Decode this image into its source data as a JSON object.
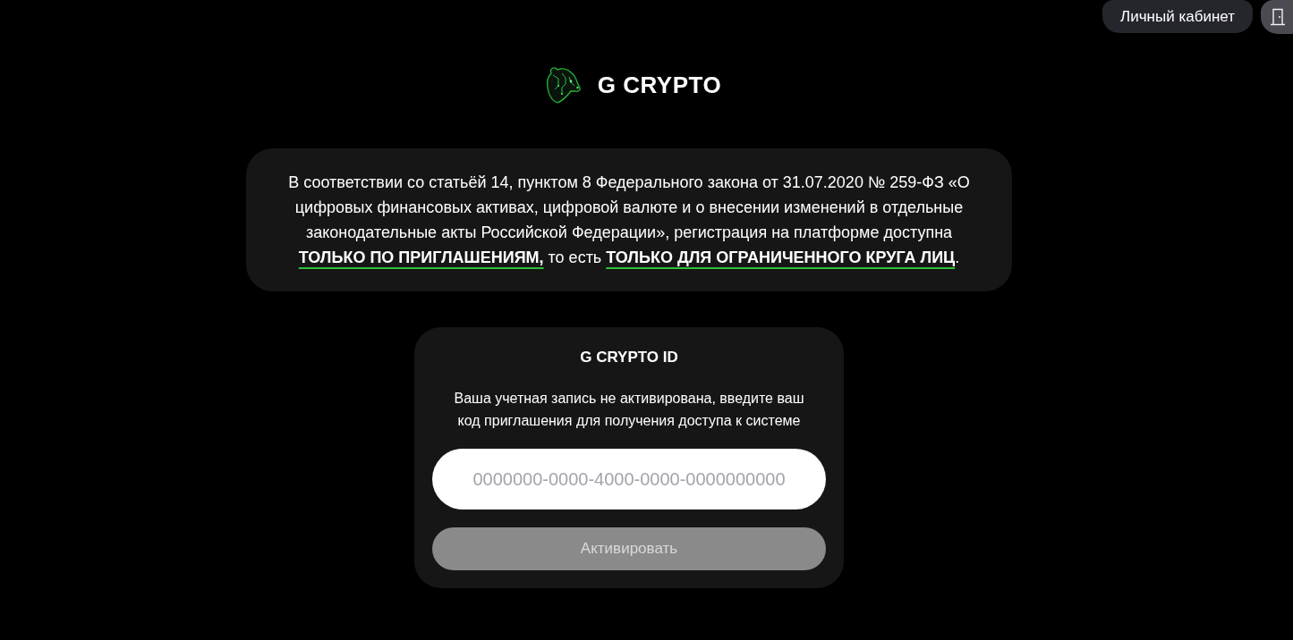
{
  "header": {
    "account_button": "Личный кабинет"
  },
  "brand": {
    "name": "G CRYPTO"
  },
  "notice": {
    "text": "В соответствии со статьёй 14, пунктом 8 Федерального закона от 31.07.2020 № 259-ФЗ «О цифровых финансовых активах, цифровой валюте и о внесении изменений в отдельные законодательные акты Российской Федерации», регистрация на платформе доступна **ТОЛЬКО ПО ПРИГЛАШЕНИЯМ,** то есть **ТОЛЬКО ДЛЯ ОГРАНИЧЕННОГО КРУГА ЛИЦ**."
  },
  "activation": {
    "title": "G CRYPTO ID",
    "message": "Ваша учетная запись не активирована, введите ваш код приглашения для получения доступа к системе",
    "code_field": {
      "placeholder": "0000000-0000-4000-0000-0000000000"
    },
    "submit": {
      "label": "Активировать",
      "disabled": true
    }
  }
}
